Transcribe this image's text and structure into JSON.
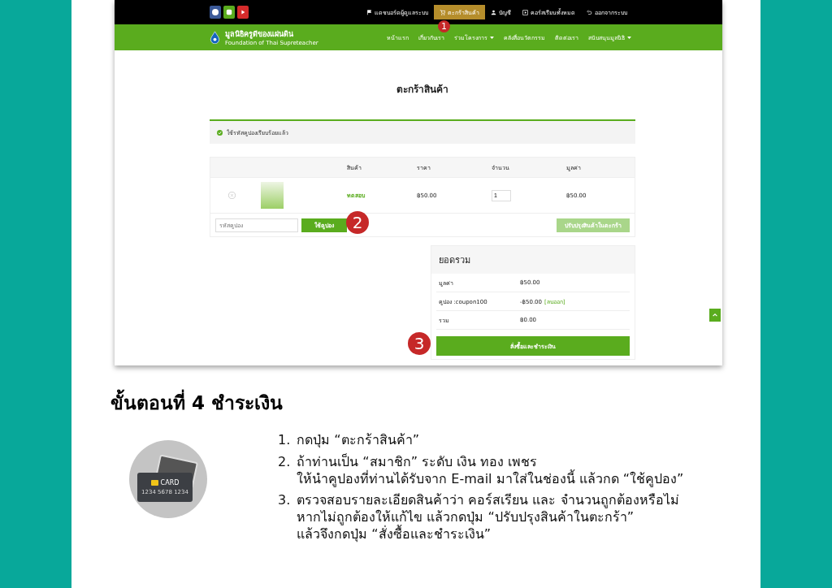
{
  "topbar": {
    "links": [
      {
        "label": "แดชบอร์ดผู้ดูแลระบบ",
        "selected": false
      },
      {
        "label": "ตะกร้าสินค้า",
        "selected": true
      },
      {
        "label": "บัญชี",
        "selected": false
      },
      {
        "label": "คอร์สเรียนทั้งหมด",
        "selected": false
      },
      {
        "label": "ออกจากระบบ",
        "selected": false
      }
    ]
  },
  "brand": {
    "name": "มูลนิธิครูดีของแผ่นดิน",
    "tagline": "Foundation of Thai Supreteacher"
  },
  "nav": [
    {
      "label": "หน้าแรก",
      "dropdown": false
    },
    {
      "label": "เกี่ยวกับเรา",
      "dropdown": false
    },
    {
      "label": "ร่วมโครงการ",
      "dropdown": true
    },
    {
      "label": "คลังสื่อนวัตกรรม",
      "dropdown": false
    },
    {
      "label": "ติดต่อเรา",
      "dropdown": false
    },
    {
      "label": "สนับสนุนมูลนิธิ",
      "dropdown": true
    }
  ],
  "page_title": "ตะกร้าสินค้า",
  "notice": "ใช้รหัสคูปองเรียบร้อยแล้ว",
  "cart": {
    "columns": [
      "สินค้า",
      "ราคา",
      "จำนวน",
      "มูลค่า"
    ],
    "rows": [
      {
        "product": "ทดสอบ",
        "price": "฿50.00",
        "quantity": "1",
        "subtotal": "฿50.00"
      }
    ],
    "coupon": {
      "placeholder": "รหัสคูปอง",
      "apply": "ใช้คูปอง"
    },
    "update": {
      "label": "ปรับปรุงสินค้าในตะกร้า",
      "disabled": true
    }
  },
  "totals": {
    "title": "ยอดรวม",
    "rows": [
      {
        "label": "มูลค่า",
        "value": "฿50.00"
      },
      {
        "label": "คูปอง :coupon100",
        "value": "-฿50.00",
        "link": "[ลบออก]"
      },
      {
        "label": "รวม",
        "value": "฿0.00"
      }
    ],
    "checkout": "สั่งซื้อและชำระเงิน"
  },
  "markers": [
    "1",
    "2",
    "3"
  ],
  "heading": "ขั้นตอนที่ 4 ชำระเงิน",
  "card_icon": {
    "label": "CARD",
    "number": "1234 5678 1234"
  },
  "steps": [
    {
      "number": "1.",
      "lines": [
        "กดปุ่ม “ตะกร้าสินค้า”"
      ]
    },
    {
      "number": "2.",
      "lines": [
        "ถ้าท่านเป็น “สมาชิก” ระดับ เงิน ทอง เพชร",
        "ให้นำคูปองที่ท่านได้รับจาก E-mail มาใส่ในช่องนี้ แล้วกด “ใช้คูปอง”"
      ]
    },
    {
      "number": "3.",
      "lines": [
        "ตรวจสอบรายละเอียดสินค้าว่า คอร์สเรียน และ จำนวนถูกต้องหรือไม่",
        "หากไม่ถูกต้องให้แก้ไข แล้วกดปุ่ม “ปรับปรุงสินค้าในตะกร้า”",
        "แล้วจึงกดปุ่ม “สั่งซื้อและชำระเงิน”"
      ]
    }
  ]
}
